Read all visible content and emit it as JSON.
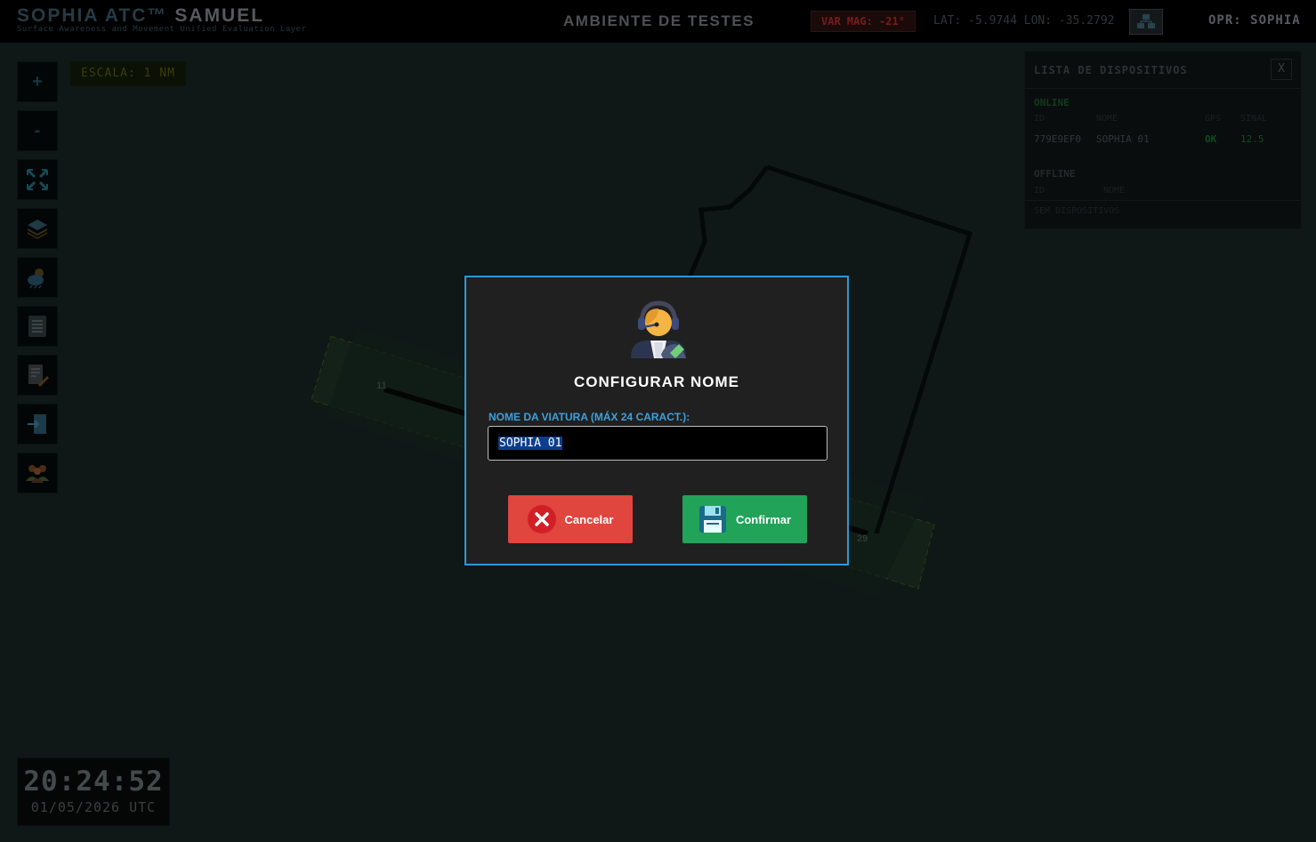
{
  "header": {
    "brand": "SOPHIA ATC™",
    "brand_sub": "SAMUEL",
    "subtitle": "Surface Awareness and Movement Unified Evaluation Layer",
    "environment": "AMBIENTE DE TESTES",
    "var_mag": "VAR MAG: -21°",
    "coords": "LAT: -5.9744 LON: -35.2792",
    "operator": "OPR: SOPHIA"
  },
  "toolbar": {
    "zoom_in": "+",
    "zoom_out": "-"
  },
  "scale": "ESCALA: 1 NM",
  "map": {
    "runway_label_a": "11",
    "runway_label_b": "29"
  },
  "device_panel": {
    "title": "LISTA DE DISPOSITIVOS",
    "close_label": "X",
    "online_title": "ONLINE",
    "online_columns": [
      "ID",
      "NOME",
      "GPS",
      "SINAL"
    ],
    "online_rows": [
      {
        "id": "779E9EF0",
        "name": "SOPHIA 01",
        "gps": "OK",
        "signal": "12.5"
      }
    ],
    "offline_title": "OFFLINE",
    "offline_columns": [
      "ID",
      "NOME"
    ],
    "offline_empty": "SEM DISPOSITIVOS"
  },
  "clock": {
    "time": "20:24:52",
    "date": "01/05/2026 UTC"
  },
  "modal": {
    "title": "CONFIGURAR NOME",
    "field_label": "NOME DA VIATURA (MÁX 24 CARACT.):",
    "field_value": "SOPHIA 01",
    "cancel_label": "Cancelar",
    "confirm_label": "Confirmar"
  },
  "colors": {
    "modal_border": "#2f98d4",
    "label_blue": "#3ea0dc",
    "cancel_red": "#e0453e",
    "confirm_green": "#21a35a"
  }
}
